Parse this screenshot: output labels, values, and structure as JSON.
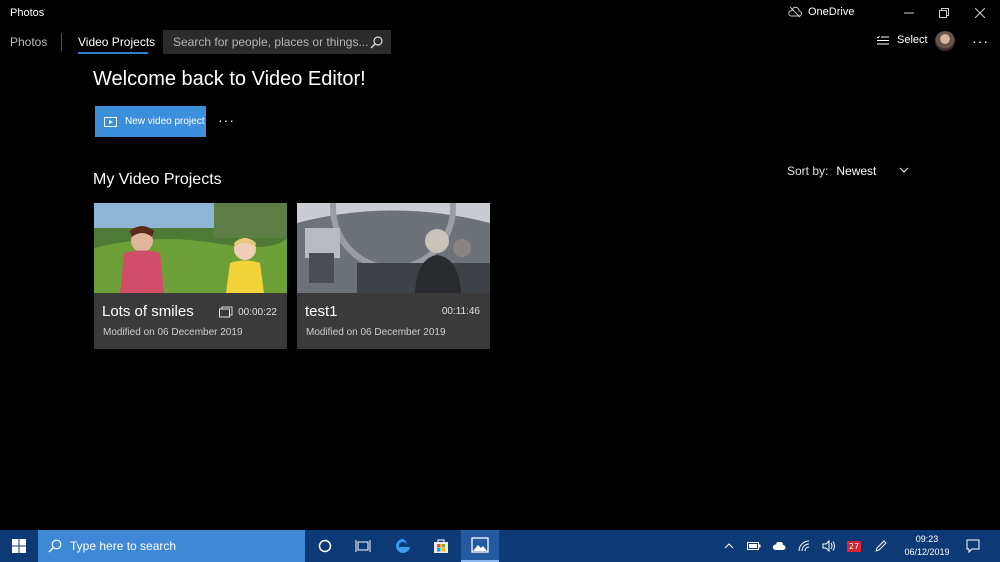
{
  "window": {
    "app_title": "Photos",
    "onedrive_label": "OneDrive"
  },
  "nav": {
    "photos_tab": "Photos",
    "video_projects_tab": "Video Projects",
    "search_placeholder": "Search for people, places or things...",
    "select_label": "Select"
  },
  "main": {
    "welcome": "Welcome back to Video Editor!",
    "new_project_label": "New video project",
    "section_title": "My Video Projects",
    "sort_label": "Sort by:",
    "sort_value": "Newest"
  },
  "projects": [
    {
      "title": "Lots of smiles",
      "duration": "00:00:22",
      "modified": "Modified on 06 December 2019"
    },
    {
      "title": "test1",
      "duration": "00:11:46",
      "modified": "Modified on 06 December 2019"
    }
  ],
  "taskbar": {
    "search_placeholder": "Type here to search",
    "time": "09:23",
    "date": "06/12/2019",
    "badge": "27"
  },
  "colors": {
    "accent": "#3c8fdb",
    "taskbar": "#0d3a75",
    "card": "#3a3a3a"
  }
}
